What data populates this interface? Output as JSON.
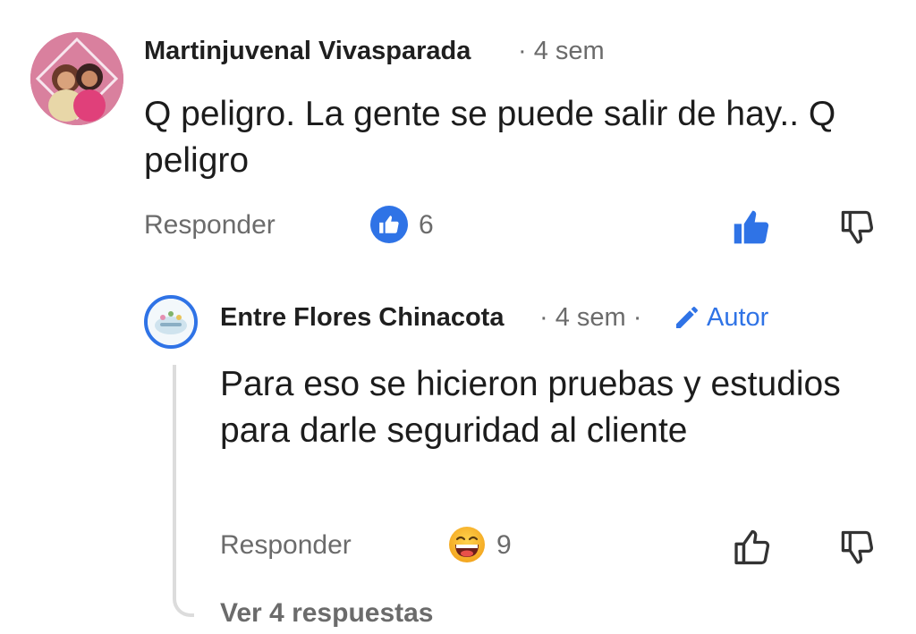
{
  "comment": {
    "author": "Martinjuvenal Vivasparada",
    "meta": "· 4 sem",
    "text": "Q peligro. La gente se puede salir de hay.. Q peligro",
    "reply_label": "Responder",
    "reaction_count": "6",
    "reaction_icon": "like-reaction-icon"
  },
  "reply": {
    "author": "Entre Flores Chinacota",
    "meta": "· 4 sem ·",
    "author_badge": "Autor",
    "text": "Para eso se hicieron pruebas y estudios para darle seguridad al cliente",
    "reply_label": "Responder",
    "reaction_count": "9",
    "reaction_icon": "laughing-emoji-icon",
    "view_replies": "Ver 4 respuestas"
  },
  "colors": {
    "accent": "#2f73e6",
    "muted_text": "#6b6b6b",
    "thread_line": "#dcdcdc"
  }
}
